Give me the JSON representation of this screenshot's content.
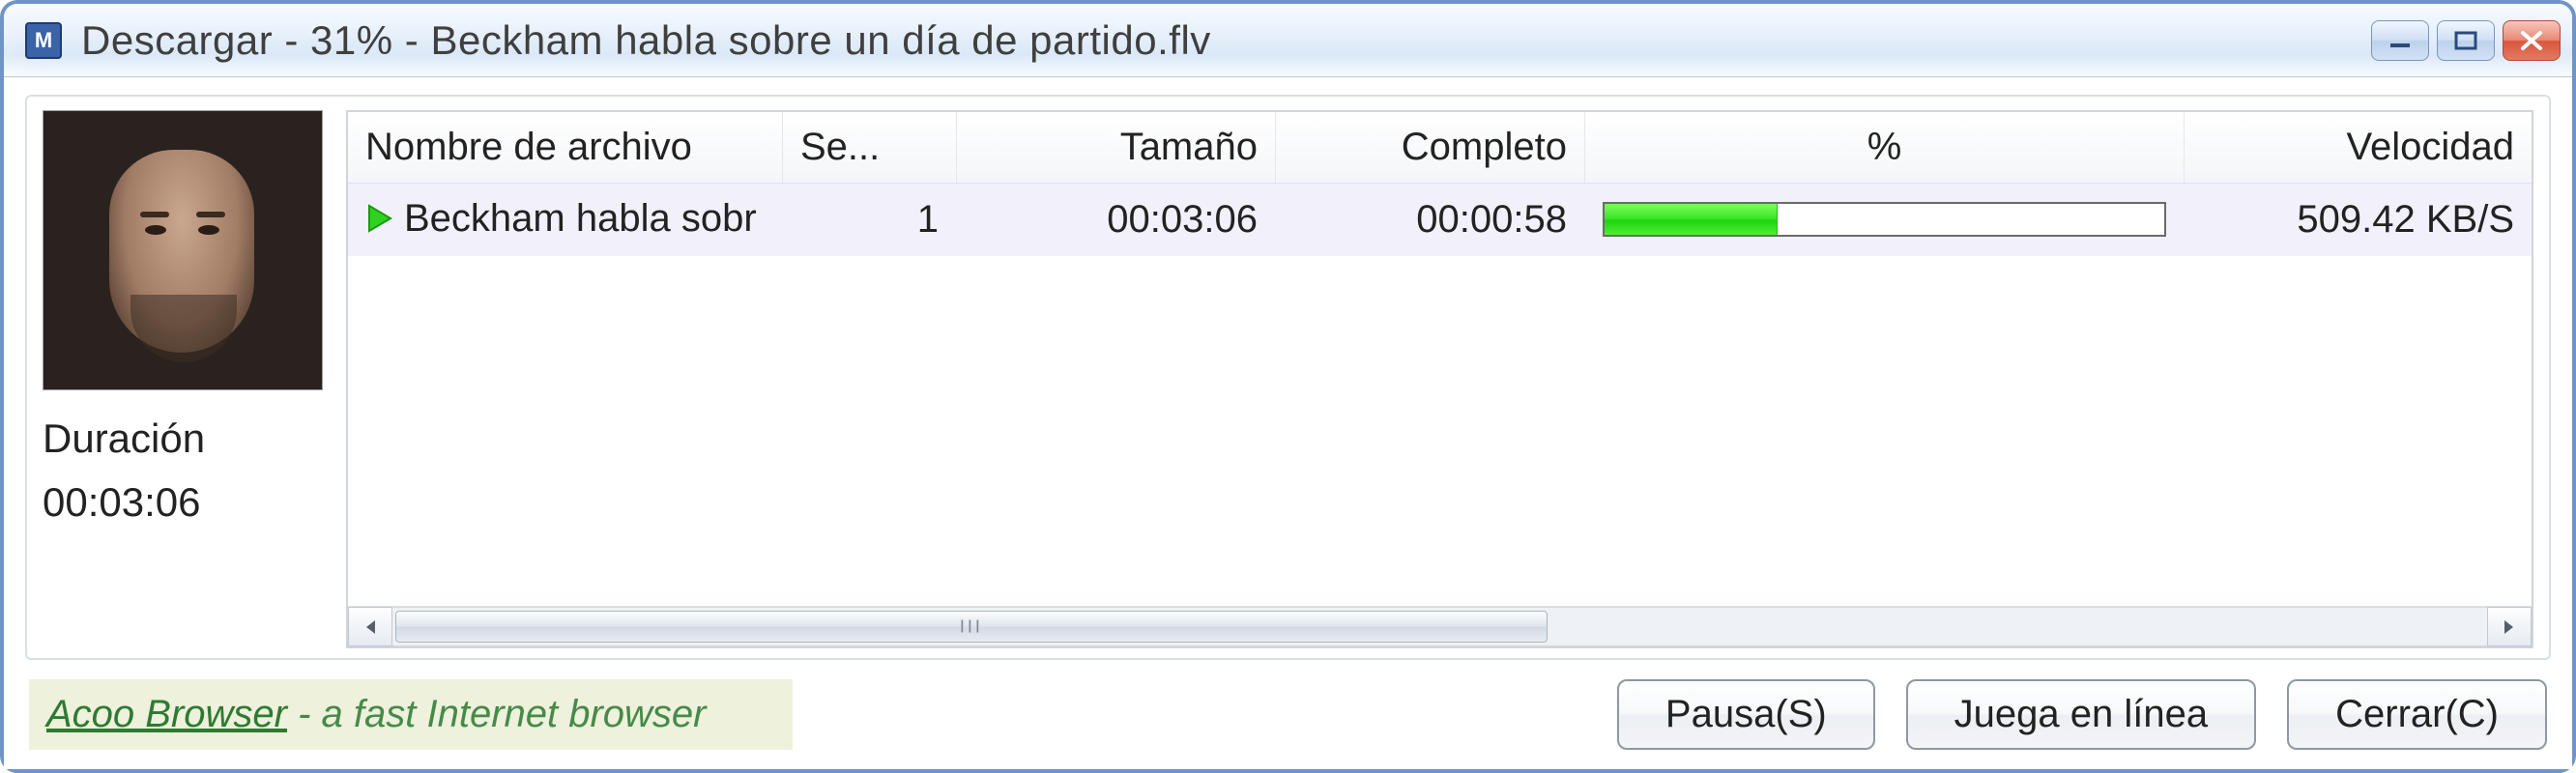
{
  "window": {
    "title": "Descargar - 31% - Beckham habla sobre un día de partido.flv"
  },
  "sidebar": {
    "duration_label": "Duración",
    "duration_value": "00:03:06"
  },
  "list": {
    "headers": {
      "filename": "Nombre de archivo",
      "section": "Se...",
      "size": "Tamaño",
      "complete": "Completo",
      "percent": "%",
      "speed": "Velocidad"
    },
    "row": {
      "filename": "Beckham habla sobr",
      "section": "1",
      "size": "00:03:06",
      "complete": "00:00:58",
      "percent_value": 31,
      "speed": "509.42 KB/S"
    }
  },
  "ad": {
    "link_text": "Acoo Browser",
    "rest_text": " - a fast Internet browser"
  },
  "buttons": {
    "pause": "Pausa(S)",
    "play_online": "Juega en línea",
    "close": "Cerrar(C)"
  }
}
